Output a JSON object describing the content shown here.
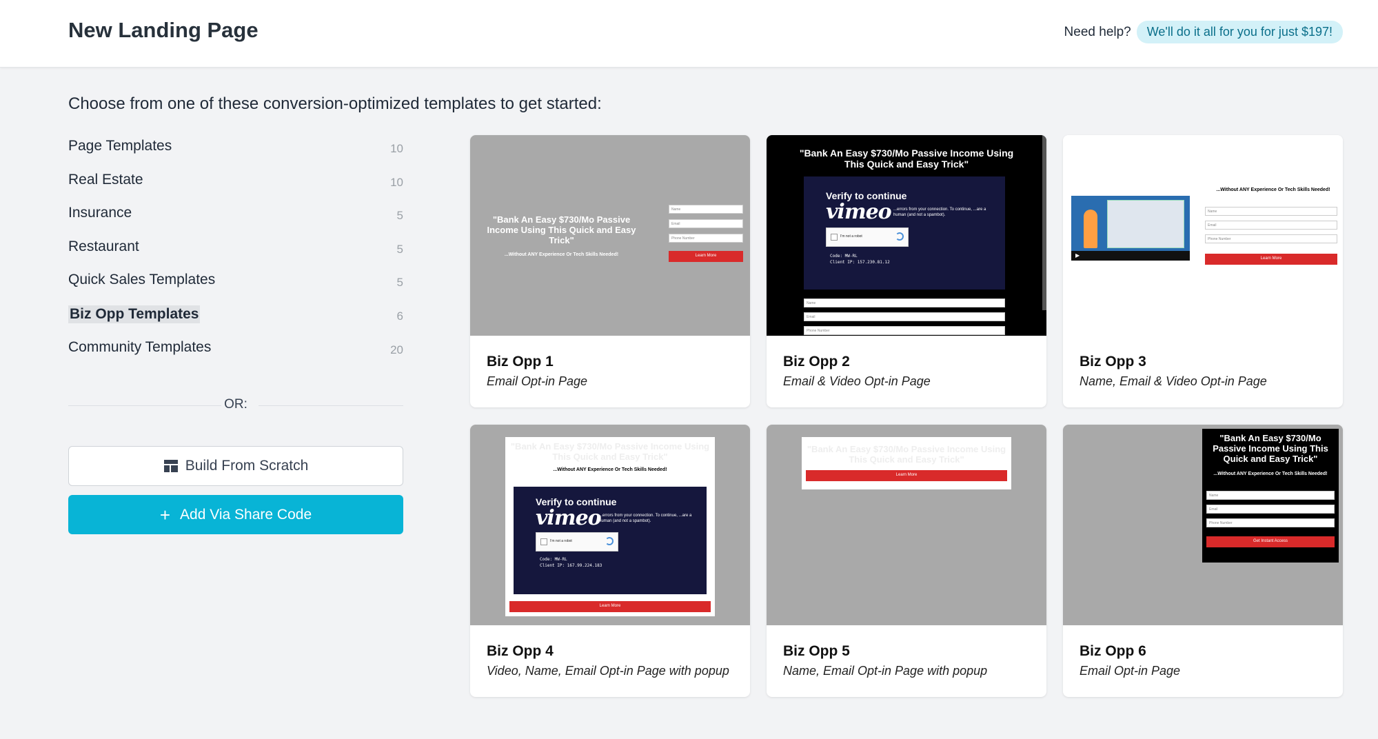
{
  "header": {
    "title": "New Landing Page",
    "help_label": "Need help?",
    "help_offer": "We'll do it all for you for just $197!"
  },
  "intro": "Choose from one of these conversion-optimized templates to get started:",
  "categories": [
    {
      "label": "Page Templates",
      "count": "10"
    },
    {
      "label": "Real Estate",
      "count": "10"
    },
    {
      "label": "Insurance",
      "count": "5"
    },
    {
      "label": "Restaurant",
      "count": "5"
    },
    {
      "label": "Quick Sales Templates",
      "count": "5"
    },
    {
      "label": "Biz Opp Templates",
      "count": "6",
      "active": true
    },
    {
      "label": "Community Templates",
      "count": "20"
    }
  ],
  "or_text": "OR:",
  "buttons": {
    "scratch": "Build From Scratch",
    "scratch_icon": "layout-icon",
    "share": "Add Via Share Code",
    "share_icon": "plus-icon"
  },
  "templates": [
    {
      "title": "Biz Opp 1",
      "subtitle": "Email Opt-in Page"
    },
    {
      "title": "Biz Opp 2",
      "subtitle": "Email & Video Opt-in Page"
    },
    {
      "title": "Biz Opp 3",
      "subtitle": "Name, Email & Video Opt-in Page"
    },
    {
      "title": "Biz Opp 4",
      "subtitle": "Video, Name, Email Opt-in Page with popup"
    },
    {
      "title": "Biz Opp 5",
      "subtitle": "Name, Email Opt-in Page with popup"
    },
    {
      "title": "Biz Opp 6",
      "subtitle": "Email Opt-in Page"
    }
  ],
  "preview": {
    "headline": "\"Bank An Easy $730/Mo Passive Income Using This Quick and Easy Trick\"",
    "subhead": "...Without ANY Experience Or Tech Skills Needed!",
    "field_name": "Name",
    "field_email": "Email",
    "field_phone": "Phone Number",
    "btn_learn": "Learn More",
    "btn_access": "Get Instant Access",
    "verify": "Verify to continue",
    "vimeo": "vimeo",
    "verify_text": "...errors from your connection. To continue, ...are a human (and not a spambot).",
    "not_robot": "I'm not a robot",
    "code": "Code: MW-RL",
    "client_ip_2": "Client IP: 157.230.81.12",
    "client_ip_4": "Client IP: 167.99.224.183"
  },
  "colors": {
    "accent": "#08b4d6",
    "offer_bg": "#d3f1f8",
    "thumb_gray": "#a9a9a9",
    "red": "#d92a2a",
    "vimeo_bg": "#15173d"
  }
}
